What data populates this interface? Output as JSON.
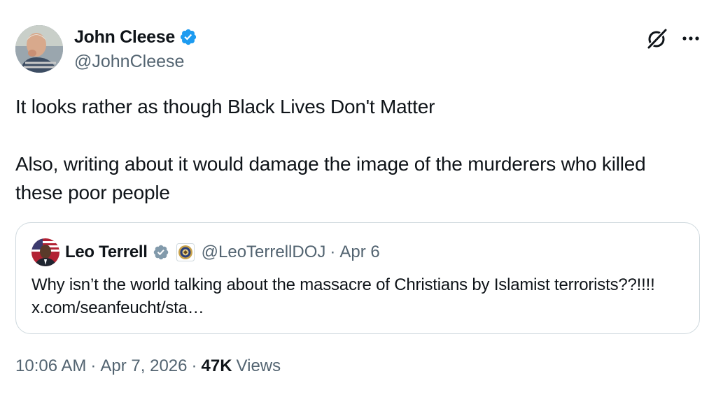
{
  "author": {
    "display_name": "John Cleese",
    "handle": "@JohnCleese",
    "verified_color": "#1d9bf0"
  },
  "post": {
    "paragraph_1": "It looks rather as though Black Lives Don't Matter",
    "paragraph_2": "Also, writing about it would damage the image of the murderers who killed these poor people"
  },
  "quoted_post": {
    "display_name": "Leo Terrell",
    "verified_color": "#829aab",
    "affiliation_icon": "doj-seal-icon",
    "handle": "@LeoTerrellDOJ",
    "separator": "·",
    "date": "Apr 6",
    "text": "Why isn’t the world talking about the massacre of Christians by Islamist terrorists??!!!! x.com/seanfeucht/sta…"
  },
  "meta": {
    "time": "10:06 AM",
    "separator_1": "·",
    "date": "Apr 7, 2026",
    "separator_2": "·",
    "views_count": "47K",
    "views_label": "Views"
  },
  "icons": {
    "grok": "grok-icon",
    "more": "more-horizontal-icon",
    "verified": "verified-badge-icon"
  }
}
